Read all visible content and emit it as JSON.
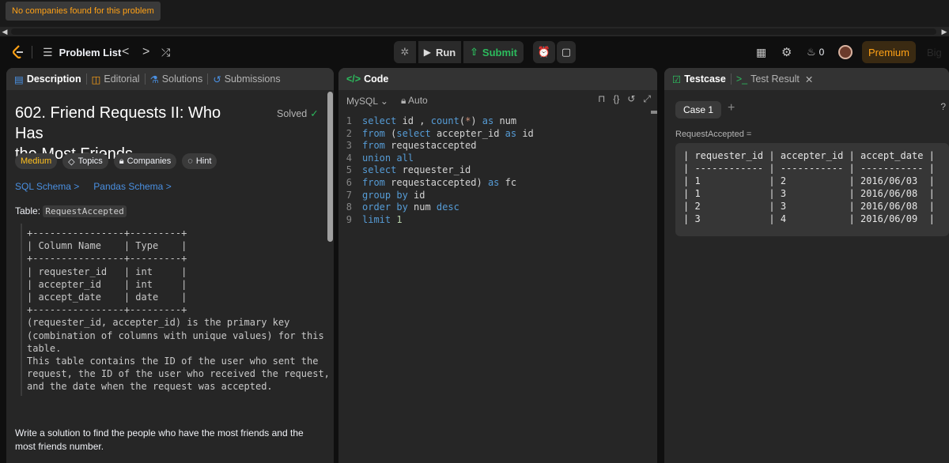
{
  "notice": "No companies found for this problem",
  "nav": {
    "problem_list": "Problem List",
    "prev": "<",
    "next": ">",
    "run": "Run",
    "submit": "Submit",
    "streak_count": "0",
    "premium": "Premium"
  },
  "description_panel": {
    "tabs": [
      "Description",
      "Editorial",
      "Solutions",
      "Submissions"
    ],
    "title_line1": "602. Friend Requests II: Who Has",
    "title_line2": "the Most Friends",
    "status": "Solved",
    "difficulty": "Medium",
    "pills": [
      "Topics",
      "Companies",
      "Hint"
    ],
    "sql_schema": "SQL Schema",
    "pandas_schema": "Pandas Schema",
    "table_label": "Table:",
    "table_name": "RequestAccepted",
    "schema_text": "+----------------+---------+\n| Column Name    | Type    |\n+----------------+---------+\n| requester_id   | int     |\n| accepter_id    | int     |\n| accept_date    | date    |\n+----------------+---------+\n(requester_id, accepter_id) is the primary key\n(combination of columns with unique values) for this\ntable.\nThis table contains the ID of the user who sent the\nrequest, the ID of the user who received the request,\nand the date when the request was accepted.",
    "solution_text": "Write a solution to find the people who have the most friends and the most friends number."
  },
  "code_panel": {
    "title": "Code",
    "language": "MySQL",
    "mode": "Auto",
    "lines": [
      {
        "n": "1",
        "parts": [
          [
            "kw",
            "select"
          ],
          [
            "plain",
            " id , "
          ],
          [
            "kw",
            "count"
          ],
          [
            "plain",
            "("
          ],
          [
            "str",
            "*"
          ],
          [
            "plain",
            ") "
          ],
          [
            "kw",
            "as"
          ],
          [
            "plain",
            " num"
          ]
        ]
      },
      {
        "n": "2",
        "parts": [
          [
            "kw",
            "from"
          ],
          [
            "plain",
            " ("
          ],
          [
            "kw",
            "select"
          ],
          [
            "plain",
            " accepter_id "
          ],
          [
            "kw",
            "as"
          ],
          [
            "plain",
            " id"
          ]
        ]
      },
      {
        "n": "3",
        "parts": [
          [
            "kw",
            "from"
          ],
          [
            "plain",
            " requestaccepted"
          ]
        ]
      },
      {
        "n": "4",
        "parts": [
          [
            "kw",
            "union all"
          ]
        ]
      },
      {
        "n": "5",
        "parts": [
          [
            "kw",
            "select"
          ],
          [
            "plain",
            " requester_id"
          ]
        ]
      },
      {
        "n": "6",
        "parts": [
          [
            "kw",
            "from"
          ],
          [
            "plain",
            " requestaccepted) "
          ],
          [
            "kw",
            "as"
          ],
          [
            "plain",
            " fc"
          ]
        ]
      },
      {
        "n": "7",
        "parts": [
          [
            "kw",
            "group by"
          ],
          [
            "plain",
            " id"
          ]
        ]
      },
      {
        "n": "8",
        "parts": [
          [
            "kw",
            "order by"
          ],
          [
            "plain",
            " num "
          ],
          [
            "kw",
            "desc"
          ]
        ]
      },
      {
        "n": "9",
        "parts": [
          [
            "kw",
            "limit"
          ],
          [
            "plain",
            " "
          ],
          [
            "num",
            "1"
          ]
        ]
      }
    ]
  },
  "test_panel": {
    "tabs": [
      "Testcase",
      "Test Result"
    ],
    "case_label": "Case 1",
    "input_label": "RequestAccepted =",
    "table_text": "| requester_id | accepter_id | accept_date |\n| ------------ | ----------- | ----------- |\n| 1            | 2           | 2016/06/03  |\n| 1            | 3           | 2016/06/08  |\n| 2            | 3           | 2016/06/08  |\n| 3            | 4           | 2016/06/09  |"
  },
  "colors": {
    "accent_orange": "#ffa116",
    "solved_green": "#2cbb5d",
    "link_blue": "#4a90e2",
    "medium_yellow": "#ffc01e"
  }
}
